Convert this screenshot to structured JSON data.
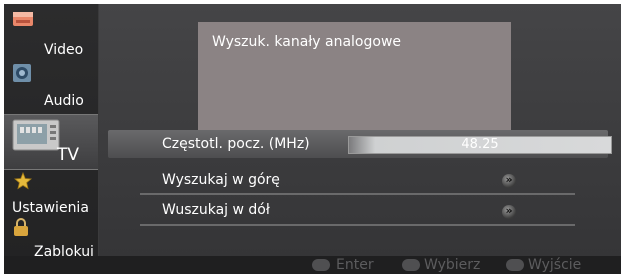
{
  "sidebar": {
    "items": [
      {
        "label": "Video",
        "icon": "video-icon"
      },
      {
        "label": "Audio",
        "icon": "audio-icon"
      },
      {
        "label": "TV",
        "icon": "tv-icon"
      },
      {
        "label": "Ustawienia",
        "icon": "star-icon"
      },
      {
        "label": "Zablokuj",
        "icon": "lock-icon"
      }
    ]
  },
  "panel": {
    "title": "Wyszuk. kanały analogowe"
  },
  "rows": {
    "freq_label": "Częstotl. pocz. (MHz)",
    "freq_value": "48.25",
    "search_up": "Wyszukaj w górę",
    "search_down": "Wuszukaj w dół"
  },
  "footer": {
    "enter": "Enter",
    "select": "Wybierz",
    "exit": "Wyjście"
  },
  "colors": {
    "accent": "#8b8384",
    "background": "#3f3f41"
  }
}
